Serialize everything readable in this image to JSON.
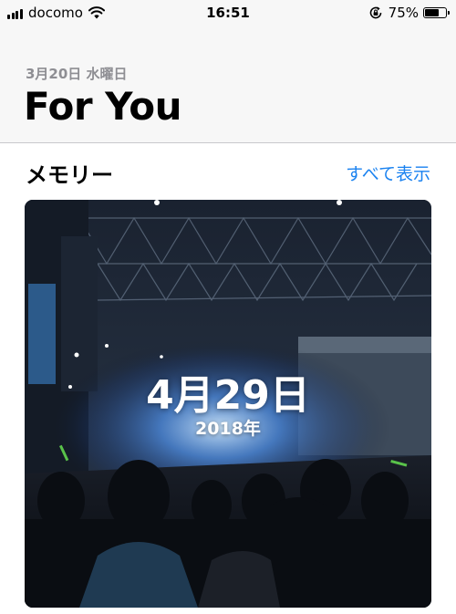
{
  "status_bar": {
    "carrier": "docomo",
    "time": "16:51",
    "battery_percent": "75%",
    "battery_level": 0.75,
    "icons": [
      "signal-icon",
      "wifi-icon",
      "rotation-lock-icon",
      "battery-icon"
    ]
  },
  "header": {
    "date": "3月20日 水曜日",
    "title": "For You"
  },
  "memories": {
    "section_title": "メモリー",
    "see_all_label": "すべて表示",
    "card": {
      "date": "4月29日",
      "year": "2018年"
    }
  },
  "colors": {
    "accent": "#1a82f0",
    "header_bg": "#f7f7f7",
    "secondary_text": "#8e8e93"
  }
}
